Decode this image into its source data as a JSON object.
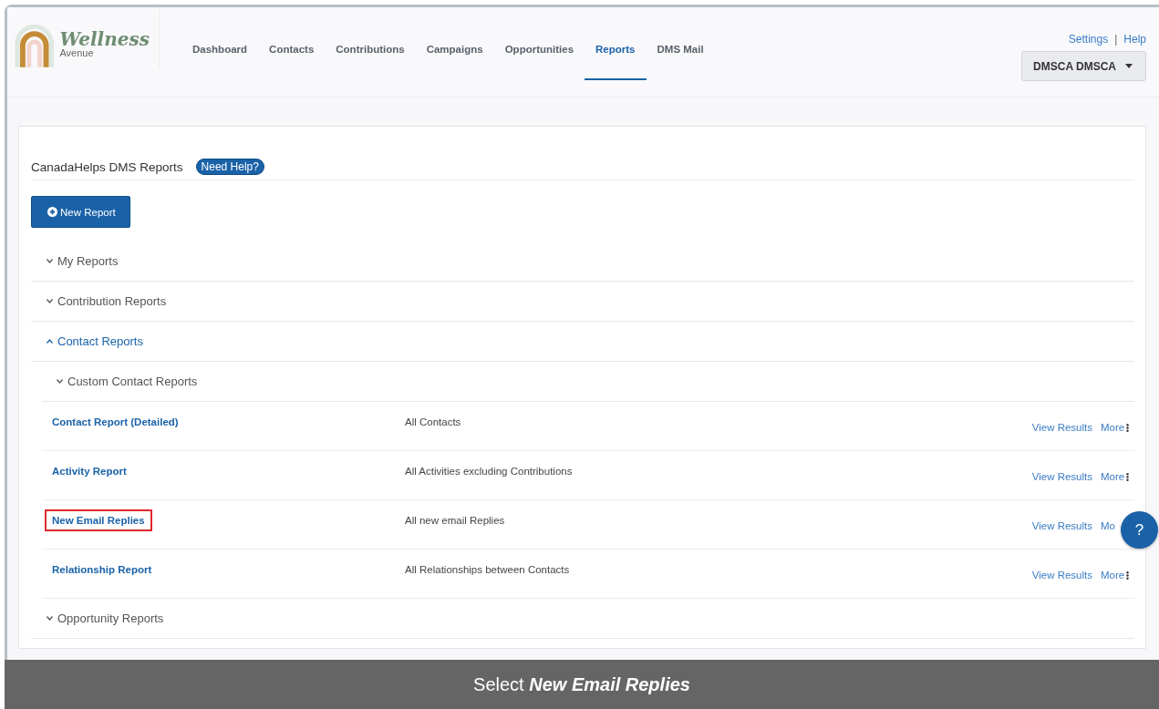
{
  "logo": {
    "name": "Wellness",
    "sub": "Avenue"
  },
  "nav": [
    {
      "label": "Dashboard",
      "selected": false
    },
    {
      "label": "Contacts",
      "selected": false
    },
    {
      "label": "Contributions",
      "selected": false
    },
    {
      "label": "Campaigns",
      "selected": false
    },
    {
      "label": "Opportunities",
      "selected": false
    },
    {
      "label": "Reports",
      "selected": true
    },
    {
      "label": "DMS Mail",
      "selected": false
    }
  ],
  "top_links": {
    "settings": "Settings",
    "separator": "|",
    "help": "Help"
  },
  "user_menu": "DMSCA DMSCA",
  "page_title": "CanadaHelps DMS Reports",
  "help_badge": "Need Help?",
  "new_report": "New Report",
  "sections": [
    {
      "label": "My Reports",
      "expanded": false
    },
    {
      "label": "Contribution Reports",
      "expanded": false
    },
    {
      "label": "Contact Reports",
      "expanded": true,
      "subsections": [
        {
          "label": "Custom Contact Reports",
          "expanded": false,
          "reports": [
            {
              "name": "Contact Report (Detailed)",
              "description": "All Contacts",
              "view": "View Results",
              "more": "More",
              "more_icon": true,
              "highlighted": false
            },
            {
              "name": "Activity Report",
              "description": "All Activities excluding Contributions",
              "view": "View Results",
              "more": "More",
              "more_icon": true,
              "highlighted": false
            },
            {
              "name": "New Email Replies",
              "description": "All new email Replies",
              "view": "View Results",
              "more": "Mo",
              "more_icon": false,
              "highlighted": true
            },
            {
              "name": "Relationship Report",
              "description": "All Relationships between Contacts",
              "view": "View Results",
              "more": "More",
              "more_icon": true,
              "highlighted": false
            }
          ]
        }
      ]
    },
    {
      "label": "Opportunity Reports",
      "expanded": false
    }
  ],
  "help_button": "?",
  "caption": "Select *New Email Replies*"
}
